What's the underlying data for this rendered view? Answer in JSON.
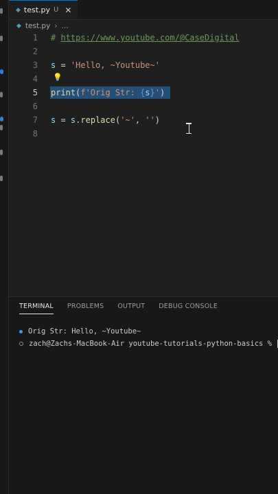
{
  "tab": {
    "filename": "test.py",
    "status": "U",
    "close_glyph": "✕",
    "icon": "python-file-icon"
  },
  "breadcrumb": {
    "file": "test.py",
    "separator": "›",
    "more": "..."
  },
  "editor": {
    "active_line": 5,
    "lines": [
      {
        "number": "1",
        "comment_prefix": "# ",
        "link": "https://www.youtube.com/@CaseDigital"
      },
      {
        "number": "2"
      },
      {
        "number": "3",
        "var": "s",
        "op": " = ",
        "string": "'Hello, ~Youtube~'"
      },
      {
        "number": "4"
      },
      {
        "number": "5",
        "fn": "print",
        "open": "(",
        "fstr_start": "f'Orig Str: ",
        "brace_open": "{",
        "inner": "s",
        "brace_close": "}",
        "fstr_end": "'",
        "close": ")"
      },
      {
        "number": "6"
      },
      {
        "number": "7",
        "var": "s",
        "op1": " = ",
        "obj": "s",
        "dot": ".",
        "method": "replace",
        "open": "(",
        "arg1": "'~'",
        "comma": ", ",
        "arg2": "''",
        "close": ")"
      },
      {
        "number": "8"
      }
    ]
  },
  "panel": {
    "tabs": [
      "TERMINAL",
      "PROBLEMS",
      "OUTPUT",
      "DEBUG CONSOLE"
    ],
    "active_tab": "TERMINAL",
    "terminal_lines": [
      "Orig Str: Hello, ~Youtube~",
      "zach@Zachs-MacBook-Air youtube-tutorials-python-basics % "
    ]
  },
  "colors": {
    "background": "#1f1f1f",
    "selection": "#264f78",
    "accent": "#0078d4",
    "comment": "#6a9955",
    "string": "#ce9178",
    "function": "#dcdcaa",
    "variable": "#9cdcfe"
  }
}
